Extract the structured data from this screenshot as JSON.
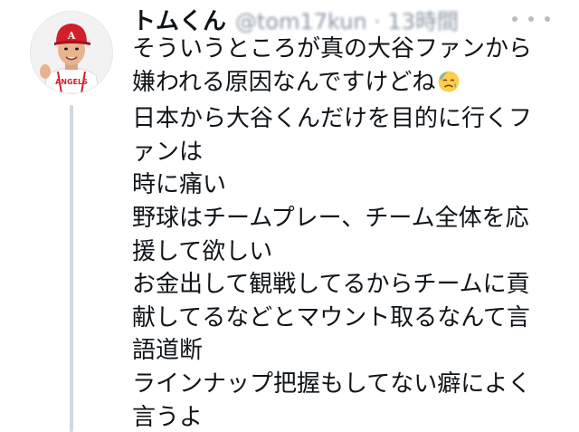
{
  "tweet": {
    "author_name": "トムくん",
    "handle_time": "@tom17kun · 13時間",
    "lines": [
      "そういうところが真の大谷ファンから",
      "嫌われる原因なんですけどね",
      "日本から大谷くんだけを目的に行くフ",
      "ァンは",
      "時に痛い",
      "野球はチームプレー、チーム全体を応",
      "援して欲しい",
      "お金出して観戦してるからチームに貢",
      "献してるなどとマウント取るなんて言",
      "語道断",
      "ラインナップ把握もしてない癖によく",
      "言うよ"
    ],
    "emoji": "sad-but-relieved-face",
    "avatar": "baseball-player-avatar",
    "colors": {
      "text": "#0f1419",
      "muted": "#8b98a5",
      "thread_line": "#cfd9de",
      "cap_red": "#d0202a"
    }
  }
}
